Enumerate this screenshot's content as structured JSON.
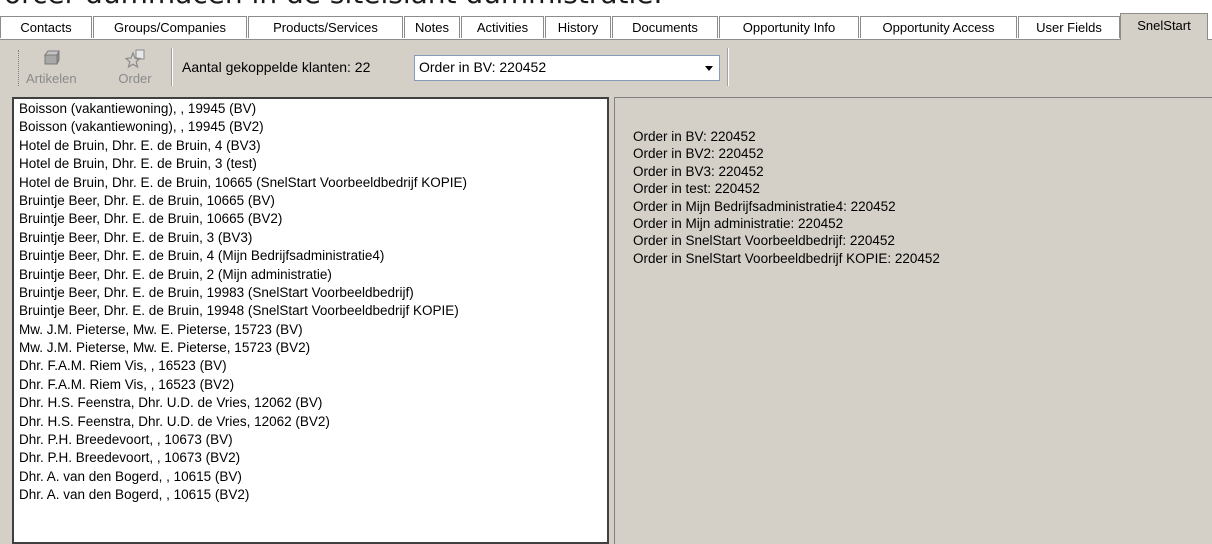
{
  "banner": {
    "text": "orcer dummacen in de siteisiant dummistratie."
  },
  "tabs": [
    {
      "label": "Contacts"
    },
    {
      "label": "Groups/Companies"
    },
    {
      "label": "Products/Services"
    },
    {
      "label": "Notes"
    },
    {
      "label": "Activities"
    },
    {
      "label": "History"
    },
    {
      "label": "Documents"
    },
    {
      "label": "Opportunity Info"
    },
    {
      "label": "Opportunity Access"
    },
    {
      "label": "User Fields"
    },
    {
      "label": "SnelStart"
    }
  ],
  "toolbar": {
    "artikelen_label": "Artikelen",
    "artikelen_icon": "articles-icon",
    "order_label": "Order",
    "order_icon": "order-star-icon",
    "count_text": "Aantal gekoppelde klanten: 22",
    "combo_value": "Order in BV: 220452"
  },
  "customers": [
    "Boisson (vakantiewoning), , 19945 (BV)",
    "Boisson (vakantiewoning), , 19945 (BV2)",
    "Hotel de Bruin, Dhr. E. de Bruin, 4 (BV3)",
    "Hotel de Bruin, Dhr. E. de Bruin, 3 (test)",
    "Hotel de Bruin, Dhr. E. de Bruin, 10665 (SnelStart Voorbeeldbedrijf KOPIE)",
    "Bruintje Beer, Dhr. E. de Bruin, 10665 (BV)",
    "Bruintje Beer, Dhr. E. de Bruin, 10665 (BV2)",
    "Bruintje Beer, Dhr. E. de Bruin, 3 (BV3)",
    "Bruintje Beer, Dhr. E. de Bruin, 4 (Mijn Bedrijfsadministratie4)",
    "Bruintje Beer, Dhr. E. de Bruin, 2 (Mijn administratie)",
    "Bruintje Beer, Dhr. E. de Bruin, 19983 (SnelStart Voorbeeldbedrijf)",
    "Bruintje Beer, Dhr. E. de Bruin, 19948 (SnelStart Voorbeeldbedrijf KOPIE)",
    "Mw. J.M. Pieterse, Mw. E. Pieterse, 15723 (BV)",
    "Mw. J.M. Pieterse, Mw. E. Pieterse, 15723 (BV2)",
    "Dhr. F.A.M. Riem Vis, , 16523 (BV)",
    "Dhr. F.A.M. Riem Vis, , 16523 (BV2)",
    "Dhr. H.S. Feenstra, Dhr. U.D. de Vries, 12062 (BV)",
    "Dhr. H.S. Feenstra, Dhr. U.D. de Vries, 12062 (BV2)",
    "Dhr. P.H. Breedevoort, , 10673 (BV)",
    "Dhr. P.H. Breedevoort, , 10673 (BV2)",
    "Dhr. A. van den Bogerd, , 10615 (BV)",
    "Dhr. A. van den Bogerd, , 10615 (BV2)"
  ],
  "orders": [
    "Order in BV: 220452",
    "Order in BV2: 220452",
    "Order in BV3: 220452",
    "Order in test: 220452",
    "Order in Mijn Bedrijfsadministratie4: 220452",
    "Order in Mijn administratie: 220452",
    "Order in SnelStart Voorbeeldbedrijf: 220452",
    "Order in SnelStart Voorbeeldbedrijf KOPIE: 220452"
  ]
}
